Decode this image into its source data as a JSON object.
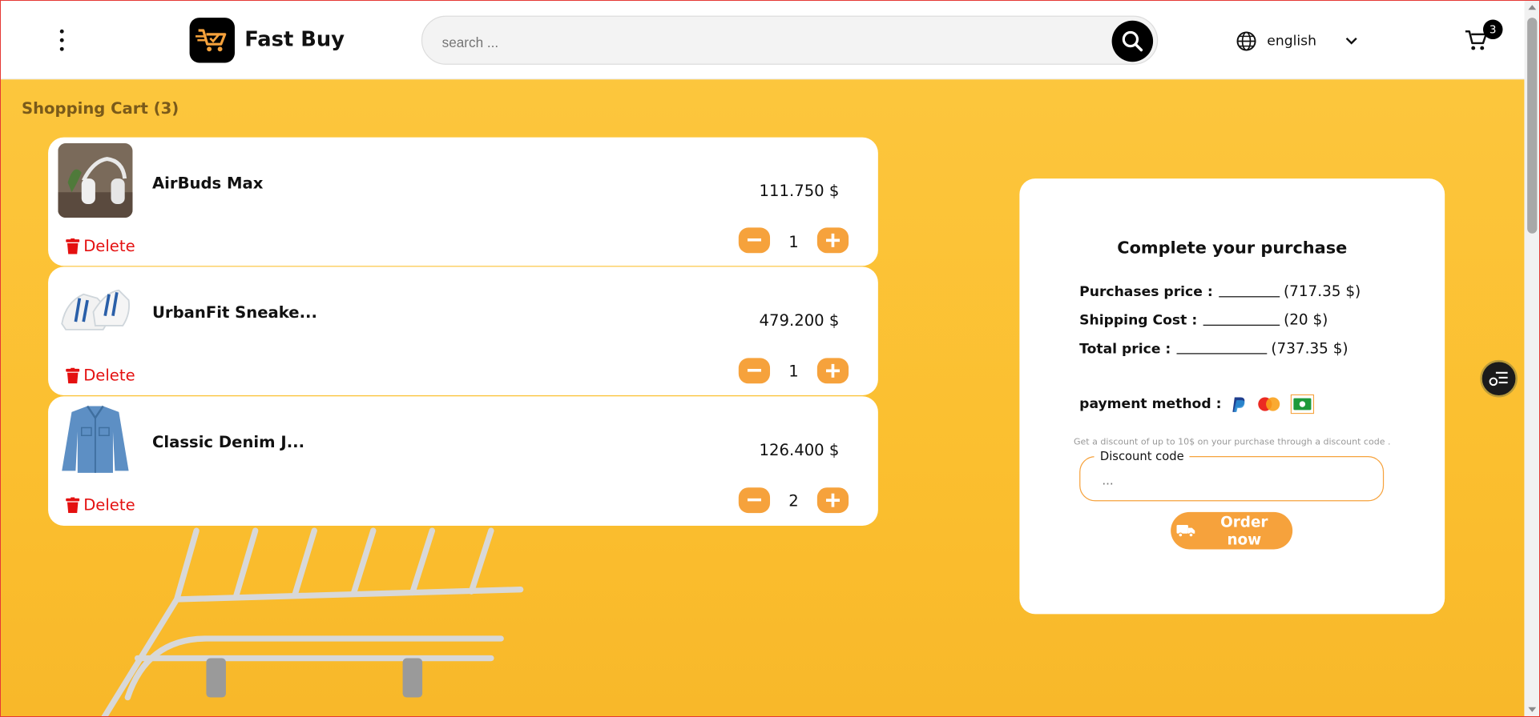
{
  "header": {
    "brand": "Fast Buy",
    "search_placeholder": "search ...",
    "language": "english",
    "cart_count": "3"
  },
  "page": {
    "title": "Shopping Cart (3)"
  },
  "items": [
    {
      "name": "AirBuds Max",
      "price": "111.750 $",
      "qty": "1",
      "delete_label": "Delete"
    },
    {
      "name": "UrbanFit Sneake...",
      "price": "479.200 $",
      "qty": "1",
      "delete_label": "Delete"
    },
    {
      "name": "Classic Denim J...",
      "price": "126.400 $",
      "qty": "2",
      "delete_label": "Delete"
    }
  ],
  "summary": {
    "title": "Complete your purchase",
    "purchases_label": "Purchases price :",
    "purchases_value": "(717.35 $)",
    "shipping_label": "Shipping Cost :",
    "shipping_value": "(20 $)",
    "total_label": "Total price :",
    "total_value": "(737.35 $)",
    "payment_label": "payment method :",
    "discount_hint": "Get a discount of up to 10$ on your purchase through a discount code .",
    "discount_label": "Discount code",
    "discount_placeholder": "...",
    "order_label": "Order now"
  },
  "colors": {
    "accent": "#f6a23c",
    "background": "#fcc63d",
    "delete": "#e41010"
  }
}
